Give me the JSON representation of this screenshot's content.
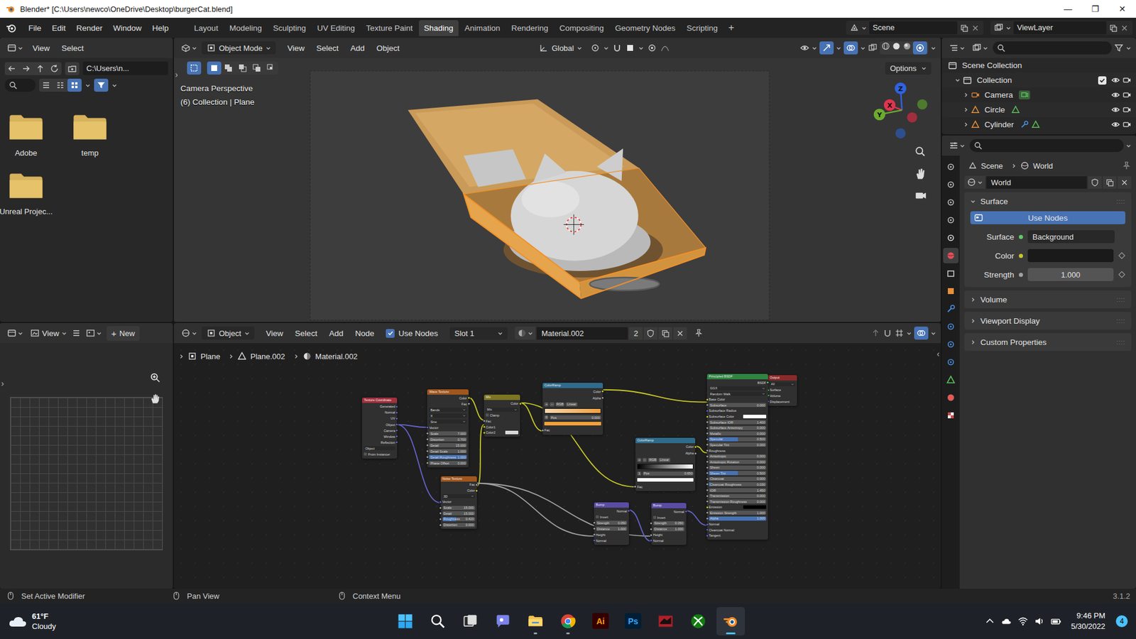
{
  "window": {
    "title": "Blender* [C:\\Users\\newco\\OneDrive\\Desktop\\burgerCat.blend]",
    "controls": [
      "—",
      "❐",
      "✕"
    ]
  },
  "menus": [
    "File",
    "Edit",
    "Render",
    "Window",
    "Help"
  ],
  "workspaces": [
    {
      "label": "Layout",
      "selected": false
    },
    {
      "label": "Modeling",
      "selected": false
    },
    {
      "label": "Sculpting",
      "selected": false
    },
    {
      "label": "UV Editing",
      "selected": false
    },
    {
      "label": "Texture Paint",
      "selected": false
    },
    {
      "label": "Shading",
      "selected": true
    },
    {
      "label": "Animation",
      "selected": false
    },
    {
      "label": "Rendering",
      "selected": false
    },
    {
      "label": "Compositing",
      "selected": false
    },
    {
      "label": "Geometry Nodes",
      "selected": false
    },
    {
      "label": "Scripting",
      "selected": false
    }
  ],
  "add_workspace": "+",
  "scene": "Scene",
  "view_layer": "ViewLayer",
  "file_browser": {
    "menus": [
      "View",
      "Select"
    ],
    "path": "C:\\Users\\n...",
    "folders": [
      "Adobe",
      "temp",
      "Unreal Projec..."
    ]
  },
  "image_editor": {
    "menus": [
      "View"
    ],
    "new_icon": "+",
    "new_button": "New"
  },
  "viewport": {
    "mode": "Object Mode",
    "menus": [
      "View",
      "Select",
      "Add",
      "Object"
    ],
    "orientation": "Global",
    "options": "Options",
    "overlay": [
      "Camera Perspective",
      "(6) Collection | Plane"
    ],
    "gizmo": [
      {
        "label": "Z",
        "color": "#2f63e0"
      },
      {
        "label": "X",
        "color": "#e0344f"
      },
      {
        "label": "Y",
        "color": "#6cab2f"
      }
    ]
  },
  "node_editor": {
    "object_type": "Object",
    "menus": [
      "View",
      "Select",
      "Add",
      "Node"
    ],
    "use_nodes": {
      "label": "Use Nodes",
      "checked": true
    },
    "slot": "Slot 1",
    "material": "Material.002",
    "users": "2",
    "breadcrumb": [
      "Plane",
      "Plane.002",
      "Material.002"
    ],
    "nodes": [
      {
        "title": "Texture Coordinate",
        "kind": "input",
        "rows": [
          {
            "kind": "out",
            "label": "Generated",
            "socket": "vector"
          },
          {
            "kind": "out",
            "label": "Normal",
            "socket": "vector"
          },
          {
            "kind": "out",
            "label": "UV",
            "socket": "vector"
          },
          {
            "kind": "out",
            "label": "Object",
            "socket": "vector"
          },
          {
            "kind": "out",
            "label": "Camera",
            "socket": "vector"
          },
          {
            "kind": "out",
            "label": "Window",
            "socket": "vector"
          },
          {
            "kind": "out",
            "label": "Reflection",
            "socket": "vector"
          },
          {
            "kind": "picker",
            "label": "Object"
          },
          {
            "kind": "check",
            "label": "From Instancer",
            "checked": false
          }
        ]
      },
      {
        "title": "Wave Texture",
        "kind": "texture",
        "rows": [
          {
            "kind": "out",
            "label": "Color",
            "socket": "color"
          },
          {
            "kind": "out",
            "label": "Fac",
            "socket": "float"
          },
          {
            "kind": "menu",
            "label": "Bands"
          },
          {
            "kind": "menu",
            "label": "X"
          },
          {
            "kind": "menu",
            "label": "Sine"
          },
          {
            "kind": "in",
            "label": "Vector",
            "socket": "vector"
          },
          {
            "kind": "field",
            "label": "Scale",
            "value": "7.000",
            "level": 0,
            "socket": "float"
          },
          {
            "kind": "field",
            "label": "Distortion",
            "value": "0.700",
            "level": 0,
            "socket": "float"
          },
          {
            "kind": "field",
            "label": "Detail",
            "value": "15.000",
            "level": 0,
            "socket": "float"
          },
          {
            "kind": "field",
            "label": "Detail Scale",
            "value": "1.000",
            "level": 0,
            "socket": "float"
          },
          {
            "kind": "field",
            "label": "Detail Roughness",
            "value": "1.000",
            "level": 1,
            "socket": "float"
          },
          {
            "kind": "field",
            "label": "Phase Offset",
            "value": "0.000",
            "level": 0,
            "socket": "float"
          }
        ]
      },
      {
        "title": "Noise Texture",
        "kind": "texture",
        "rows": [
          {
            "kind": "out",
            "label": "Fac",
            "socket": "float"
          },
          {
            "kind": "out",
            "label": "Color",
            "socket": "color"
          },
          {
            "kind": "menu",
            "label": "3D"
          },
          {
            "kind": "in",
            "label": "Vector",
            "socket": "vector"
          },
          {
            "kind": "field",
            "label": "Scale",
            "value": "15.000",
            "level": 0,
            "socket": "float"
          },
          {
            "kind": "field",
            "label": "Detail",
            "value": "15.000",
            "level": 0,
            "socket": "float"
          },
          {
            "kind": "field",
            "label": "Roughness",
            "value": "0.420",
            "level": 0.42,
            "socket": "float"
          },
          {
            "kind": "field",
            "label": "Distortion",
            "value": "0.000",
            "level": 0,
            "socket": "float"
          }
        ]
      },
      {
        "title": "Mix",
        "kind": "color",
        "rows": [
          {
            "kind": "out",
            "label": "Color",
            "socket": "color"
          },
          {
            "kind": "menu",
            "label": "Mix"
          },
          {
            "kind": "check",
            "label": "Clamp",
            "checked": false
          },
          {
            "kind": "in",
            "label": "Fac",
            "socket": "float"
          },
          {
            "kind": "in",
            "label": "Color1",
            "socket": "color"
          },
          {
            "kind": "swatch",
            "label": "Color2",
            "color": "#d9d9d9",
            "socket": "color"
          }
        ]
      },
      {
        "title": "ColorRamp",
        "kind": "converter",
        "rows": [
          {
            "kind": "out",
            "label": "Color",
            "socket": "color"
          },
          {
            "kind": "out",
            "label": "Alpha",
            "socket": "float"
          },
          {
            "kind": "controls",
            "items": [
              "+",
              "−",
              "RGB",
              "Linear"
            ]
          },
          {
            "kind": "ramp",
            "colors": [
              "#f9d7ad",
              "#f0a040"
            ]
          },
          {
            "kind": "pos",
            "index": "0",
            "label": "Pos",
            "value": "0.000"
          },
          {
            "kind": "swatch",
            "color": "#f2a13a"
          },
          {
            "kind": "in",
            "label": "Fac",
            "socket": "float"
          }
        ]
      },
      {
        "title": "ColorRamp",
        "kind": "converter",
        "rows": [
          {
            "kind": "out",
            "label": "Color",
            "socket": "color"
          },
          {
            "kind": "out",
            "label": "Alpha",
            "socket": "float"
          },
          {
            "kind": "controls",
            "items": [
              "+",
              "−",
              "RGB",
              "Linear"
            ]
          },
          {
            "kind": "ramp",
            "colors": [
              "#000000",
              "#ffffff"
            ]
          },
          {
            "kind": "pos",
            "index": "1",
            "label": "Pos",
            "value": "0.650"
          },
          {
            "kind": "swatch",
            "color": "#ffffff"
          },
          {
            "kind": "in",
            "label": "Fac",
            "socket": "float"
          }
        ]
      },
      {
        "title": "Bump",
        "kind": "vector",
        "rows": [
          {
            "kind": "out",
            "label": "Normal",
            "socket": "vector"
          },
          {
            "kind": "check",
            "label": "Invert",
            "checked": false
          },
          {
            "kind": "field",
            "label": "Strength",
            "value": "0.050",
            "level": 0,
            "socket": "float"
          },
          {
            "kind": "field",
            "label": "Distance",
            "value": "1.000",
            "level": 0,
            "socket": "float"
          },
          {
            "kind": "in",
            "label": "Height",
            "socket": "float"
          },
          {
            "kind": "in",
            "label": "Normal",
            "socket": "vector"
          }
        ]
      },
      {
        "title": "Bump",
        "kind": "vector",
        "rows": [
          {
            "kind": "out",
            "label": "Normal",
            "socket": "vector"
          },
          {
            "kind": "check",
            "label": "Invert",
            "checked": false
          },
          {
            "kind": "field",
            "label": "Strength",
            "value": "0.050",
            "level": 0,
            "socket": "float"
          },
          {
            "kind": "field",
            "label": "Distance",
            "value": "1.000",
            "level": 0,
            "socket": "float"
          },
          {
            "kind": "in",
            "label": "Height",
            "socket": "float"
          },
          {
            "kind": "in",
            "label": "Normal",
            "socket": "vector"
          }
        ]
      },
      {
        "title": "Output",
        "kind": "output",
        "rows": [
          {
            "kind": "menu",
            "label": "All"
          },
          {
            "kind": "in",
            "label": "Surface",
            "socket": "shader"
          },
          {
            "kind": "in",
            "label": "Volume",
            "socket": "shader"
          },
          {
            "kind": "in",
            "label": "Displacement",
            "socket": "vector"
          }
        ]
      },
      {
        "title": "Principled BSDF",
        "kind": "shader",
        "rows": [
          {
            "kind": "out",
            "label": "BSDF",
            "socket": "shader"
          },
          {
            "kind": "menu",
            "label": "GGX"
          },
          {
            "kind": "menu",
            "label": "Random Walk"
          },
          {
            "kind": "in",
            "label": "Base Color",
            "socket": "color"
          },
          {
            "kind": "field",
            "label": "Subsurface",
            "value": "0.000",
            "level": 0,
            "socket": "float"
          },
          {
            "kind": "in",
            "label": "Subsurface Radius",
            "socket": "vector"
          },
          {
            "kind": "swatch",
            "label": "Subsurface Color",
            "color": "#ffffff",
            "socket": "color"
          },
          {
            "kind": "field",
            "label": "Subsurface IOR",
            "value": "1.400",
            "level": 0,
            "socket": "float"
          },
          {
            "kind": "field",
            "label": "Subsurface Anisotropy",
            "value": "0.000",
            "level": 0,
            "socket": "float"
          },
          {
            "kind": "field",
            "label": "Metallic",
            "value": "0.000",
            "level": 0,
            "socket": "float"
          },
          {
            "kind": "field",
            "label": "Specular",
            "value": "0.500",
            "level": 0.5,
            "socket": "float"
          },
          {
            "kind": "field",
            "label": "Specular Tint",
            "value": "0.000",
            "level": 0,
            "socket": "float"
          },
          {
            "kind": "in",
            "label": "Roughness",
            "socket": "float"
          },
          {
            "kind": "field",
            "label": "Anisotropic",
            "value": "0.000",
            "level": 0,
            "socket": "float"
          },
          {
            "kind": "field",
            "label": "Anisotropic Rotation",
            "value": "0.000",
            "level": 0,
            "socket": "float"
          },
          {
            "kind": "field",
            "label": "Sheen",
            "value": "0.000",
            "level": 0,
            "socket": "float"
          },
          {
            "kind": "field",
            "label": "Sheen Tint",
            "value": "0.500",
            "level": 0.5,
            "socket": "float"
          },
          {
            "kind": "field",
            "label": "Clearcoat",
            "value": "0.000",
            "level": 0,
            "socket": "float"
          },
          {
            "kind": "field",
            "label": "Clearcoat Roughness",
            "value": "0.030",
            "level": 0.03,
            "socket": "float"
          },
          {
            "kind": "field",
            "label": "IOR",
            "value": "1.450",
            "level": 0,
            "socket": "float"
          },
          {
            "kind": "field",
            "label": "Transmission",
            "value": "0.000",
            "level": 0,
            "socket": "float"
          },
          {
            "kind": "field",
            "label": "Transmission Roughness",
            "value": "0.000",
            "level": 0,
            "socket": "float"
          },
          {
            "kind": "swatch",
            "label": "Emission",
            "color": "#000000",
            "socket": "color"
          },
          {
            "kind": "field",
            "label": "Emission Strength",
            "value": "1.000",
            "level": 0,
            "socket": "float"
          },
          {
            "kind": "field",
            "label": "Alpha",
            "value": "1.000",
            "level": 1,
            "socket": "float"
          },
          {
            "kind": "in",
            "label": "Normal",
            "socket": "vector"
          },
          {
            "kind": "in",
            "label": "Clearcoat Normal",
            "socket": "vector"
          },
          {
            "kind": "in",
            "label": "Tangent",
            "socket": "vector"
          }
        ]
      }
    ]
  },
  "outliner": {
    "root": "Scene Collection",
    "collection": {
      "label": "Collection",
      "checked": true,
      "expanded": true
    },
    "items": [
      {
        "label": "Camera",
        "kind": "camera"
      },
      {
        "label": "Circle",
        "kind": "mesh"
      },
      {
        "label": "Cylinder",
        "kind": "modified"
      }
    ]
  },
  "properties": {
    "tabs": [
      {
        "kind": "tool",
        "selected": false
      },
      {
        "kind": "render",
        "selected": false
      },
      {
        "kind": "output",
        "selected": false
      },
      {
        "kind": "view_layer",
        "selected": false
      },
      {
        "kind": "scene",
        "selected": false
      },
      {
        "kind": "world",
        "selected": true
      },
      {
        "kind": "collection",
        "selected": false
      },
      {
        "kind": "object",
        "selected": false
      },
      {
        "kind": "modifiers",
        "selected": false
      },
      {
        "kind": "particles",
        "selected": false
      },
      {
        "kind": "physics",
        "selected": false
      },
      {
        "kind": "constraints",
        "selected": false
      },
      {
        "kind": "data",
        "selected": false
      },
      {
        "kind": "material",
        "selected": false
      },
      {
        "kind": "texture",
        "selected": false
      }
    ],
    "breadcrumb": [
      "Scene",
      "World"
    ],
    "world": "World",
    "surface": {
      "label": "Surface",
      "expanded": true,
      "use_nodes": "Use Nodes",
      "rows": [
        {
          "label": "Surface",
          "kind": "shader",
          "value": "Background"
        },
        {
          "label": "Color",
          "kind": "color"
        },
        {
          "label": "Strength",
          "kind": "number",
          "value": "1.000"
        }
      ]
    },
    "panels": [
      {
        "label": "Volume",
        "expanded": false
      },
      {
        "label": "Viewport Display",
        "expanded": false
      },
      {
        "label": "Custom Properties",
        "expanded": false
      }
    ]
  },
  "status_bar": {
    "hints": [
      "Set Active Modifier",
      "Pan View",
      "Context Menu"
    ],
    "version": "3.1.2"
  },
  "taskbar": {
    "weather": {
      "temp": "61°F",
      "desc": "Cloudy"
    },
    "apps": [
      {
        "kind": "start",
        "running": false,
        "active": false
      },
      {
        "kind": "search",
        "running": false,
        "active": false
      },
      {
        "kind": "taskview",
        "running": false,
        "active": false
      },
      {
        "kind": "chat",
        "running": false,
        "active": false
      },
      {
        "kind": "explorer",
        "running": true,
        "active": false
      },
      {
        "kind": "chrome",
        "running": true,
        "active": false
      },
      {
        "kind": "illustrator",
        "label": "Ai",
        "running": false,
        "active": false
      },
      {
        "kind": "photoshop",
        "label": "Ps",
        "running": false,
        "active": false
      },
      {
        "kind": "game",
        "running": false,
        "active": false
      },
      {
        "kind": "xbox",
        "running": false,
        "active": false
      },
      {
        "kind": "blender",
        "running": true,
        "active": true
      }
    ],
    "time": "9:46 PM",
    "date": "5/30/2022",
    "notifications": "4"
  }
}
